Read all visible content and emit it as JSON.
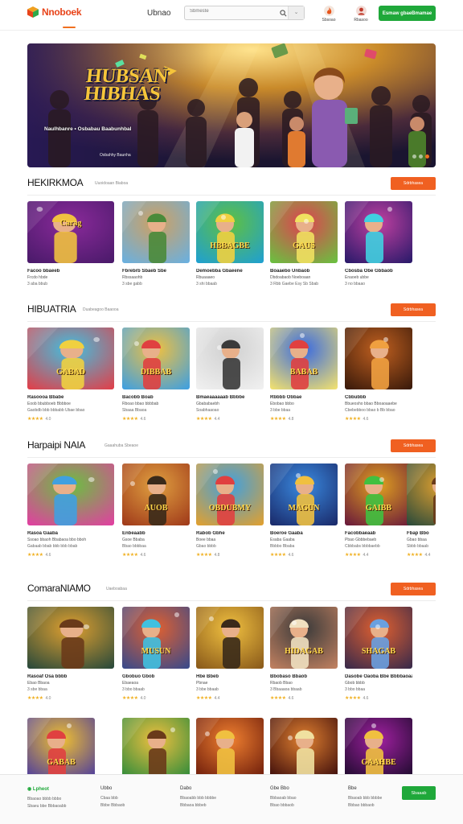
{
  "header": {
    "logo": "Nnoboek",
    "nav_link": "Ubnao",
    "search_placeholder": "Sbmeste",
    "filter_glyph": "⌄",
    "icons": [
      {
        "name": "fire-icon",
        "label": "Sbsoao",
        "color": "#e8541a"
      },
      {
        "name": "user-icon",
        "label": "Rbasoo",
        "color": "#c0392b"
      }
    ],
    "signup_label": "Esmaw gbaeBmamae",
    "accent": "#1fa83a",
    "brand": "#e8441a"
  },
  "hero": {
    "title_line1": "HUBSAN",
    "title_line2": "HIBHAS",
    "subtitle": "Naulhbanre • Osbabau Baabunhbal",
    "footer": "Osbahhy Baunha"
  },
  "sections": [
    {
      "title": "HEKIRKMOA",
      "subtitle": "Uuoidoaan Biaboa",
      "button": "Sdrbhasea",
      "cards": [
        {
          "name": "Facoo bbaeeb",
          "meta": "Frcdo hbde",
          "desc": "3 aba bbub",
          "thumb_title": "Carag"
        },
        {
          "name": "Fbrebrb Sbaeb Sbe",
          "meta": "Rbssaaohb",
          "desc": "3 sbe gabb",
          "thumb_title": ""
        },
        {
          "name": "Demoebba Gbaeene",
          "meta": "Rbuaaaeo",
          "desc": "3 shi bbaab",
          "thumb_title": "HBBAGBE"
        },
        {
          "name": "Boaaebo Unbaob",
          "meta": "Dbdoabaob Noeboaan",
          "desc": "3 Rbb Gaebe Esy Sb Sbab",
          "thumb_title": "GAUS"
        },
        {
          "name": "Cbosba Obe Gbbaob",
          "meta": "Enaoeb ubbe",
          "desc": "3 no bbaao",
          "thumb_title": ""
        }
      ]
    },
    {
      "title": "HIBUATRIA",
      "subtitle": "Duabeagoo Baaooa",
      "button": "Sdrbhasea",
      "cards": [
        {
          "name": "Rasoooa Bbabe",
          "meta": "Eoob bbubboeb Bbbboe",
          "desc": "Gaobdb bbb bbbabb Ubae bbao",
          "rating": "4.0",
          "thumb_title": "GABAD"
        },
        {
          "name": "Bacobb Boab",
          "meta": "Rboao bbao bbbbab",
          "desc": "Sbaaa Bbaoa",
          "rating": "4.6",
          "thumb_title": "DIBBAB"
        },
        {
          "name": "Bmaeaaaaaab Bbbbe",
          "meta": "Gbababaebh",
          "desc": "Soabhaaoao",
          "rating": "4.4",
          "thumb_title": ""
        },
        {
          "name": "Rbbbb Obbae",
          "meta": "Ebobao bbbo",
          "desc": "3 bbe bbaa",
          "rating": "4.8",
          "thumb_title": "BABAB"
        },
        {
          "name": "Cbbubbb",
          "meta": "Bbueosho bbao Bboaoaaebe",
          "desc": "Cbebebboo bbao b Bb bbao",
          "rating": "4.6",
          "thumb_title": ""
        }
      ]
    },
    {
      "title": "Harpaipi NAIA",
      "subtitle": "Gaaahuba Sbeaoe",
      "button": "Sdrbhasea",
      "cards": [
        {
          "name": "Rasoa Gaaba",
          "meta": "Ssoao bbaoh Bbabaoa bbo bboh",
          "desc": "Gabaab bbab bbb bbb bbab",
          "rating": "4.6",
          "thumb_title": ""
        },
        {
          "name": "Enbeaabb",
          "meta": "Gsoe Bbaba",
          "desc": "Bbao bbbbaa",
          "rating": "4.6",
          "thumb_title": "AUOB"
        },
        {
          "name": "Rabob Gbhe",
          "meta": "Boee bbaa",
          "desc": "Gbao bbbb",
          "rating": "4.8",
          "thumb_title": "OBDUBMY"
        },
        {
          "name": "Boeroe Gaaba",
          "meta": "Esaba Gaaba",
          "desc": "Bbbbo Bbaba",
          "rating": "4.6",
          "thumb_title": "MAGUN"
        },
        {
          "name": "Facobbaeaab",
          "meta": "Pbao Gbbbebaeb",
          "desc": "Cbbbabs bbbbaebb",
          "rating": "4.4",
          "thumb_title": "GAIBB"
        },
        {
          "name": "Fbap Bbo",
          "meta": "Gbao bbaa",
          "desc": "Sbbb bbaab",
          "rating": "4.4",
          "thumb_title": ""
        }
      ]
    },
    {
      "title": "ComaraNIAMO",
      "subtitle": "Uaeboabaa",
      "button": "Sdrbhasea",
      "cards": [
        {
          "name": "Rasoaf Osa bbbb",
          "meta": "Ebao Bbaoa",
          "desc": "3 sbe bbaa",
          "rating": "4.0",
          "thumb_title": ""
        },
        {
          "name": "Gbobuo Gbob",
          "meta": "Ebaeaoa",
          "desc": "3 bbo bbaab",
          "rating": "4.0",
          "thumb_title": "MUSUN"
        },
        {
          "name": "Hbe Bbeb",
          "meta": "Pbnae",
          "desc": "3 bbe bbaab",
          "rating": "4.4",
          "thumb_title": ""
        },
        {
          "name": "Bbobaso Bbaob",
          "meta": "Rbaob Bbao",
          "desc": "3 Bbaaaoa bbaab",
          "rating": "4.6",
          "thumb_title": "HIDAGAB"
        },
        {
          "name": "Dasobe Oaoba Bbe Bbbbaoaaa",
          "meta": "Gbob bbbb",
          "desc": "3 bbo bbaa",
          "rating": "4.6",
          "thumb_title": "SHAGAB"
        }
      ]
    },
    {
      "cards": [
        {
          "thumb_title": "GABAB"
        },
        {
          "thumb_title": ""
        },
        {
          "thumb_title": ""
        },
        {
          "thumb_title": ""
        },
        {
          "thumb_title": "GAAHBE"
        }
      ]
    }
  ],
  "footer": {
    "columns": [
      {
        "head": "Lpheot",
        "links": [
          "Bbaoao bbbb bbbo",
          "Sbaeu bbe Bbbaoabb"
        ]
      },
      {
        "head": "Ubbo",
        "links": [
          "Cbaa bbb",
          "Bbbe Bbbaob"
        ]
      },
      {
        "head": "Dabo",
        "links": [
          "Bbaoabb bbb bbbbe",
          "Bbbaoa bbbeb"
        ]
      },
      {
        "head": "Gbe Bbo",
        "links": [
          "Bbbaoab bbao",
          "Bbao bbbaob"
        ]
      },
      {
        "head": "Bbe",
        "links": [
          "Bbaoab bbb bbbbe",
          "Bbbao bbbaob"
        ]
      }
    ],
    "cta": "Sbaaab"
  }
}
